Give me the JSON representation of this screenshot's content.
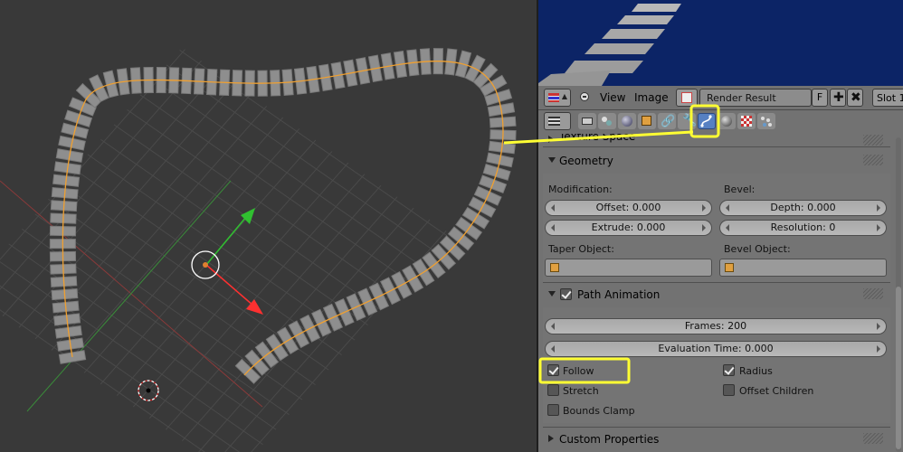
{
  "image_editor": {
    "menu_view": "View",
    "menu_image": "Image",
    "image_name": "Render Result",
    "fake_user": "F",
    "slot": "Slot 1"
  },
  "properties": {
    "texture_space": {
      "title": "Texture Space"
    },
    "geometry": {
      "title": "Geometry",
      "modification_label": "Modification:",
      "bevel_label": "Bevel:",
      "offset": "Offset: 0.000",
      "extrude": "Extrude: 0.000",
      "depth": "Depth: 0.000",
      "resolution": "Resolution: 0",
      "taper_label": "Taper Object:",
      "bevel_object_label": "Bevel Object:"
    },
    "path_animation": {
      "title": "Path Animation",
      "enabled": true,
      "frames": "Frames: 200",
      "evaluation_time": "Evaluation Time: 0.000",
      "follow": {
        "label": "Follow",
        "checked": true
      },
      "radius": {
        "label": "Radius",
        "checked": true
      },
      "stretch": {
        "label": "Stretch",
        "checked": false
      },
      "offset_children": {
        "label": "Offset Children",
        "checked": false
      },
      "bounds_clamp": {
        "label": "Bounds Clamp",
        "checked": false
      }
    },
    "custom_properties": {
      "title": "Custom Properties"
    }
  },
  "colors": {
    "highlight": "#ffff33",
    "curve": "#f0a030",
    "axis_x": "#ff3030",
    "axis_y": "#30c030",
    "render_bg": "#0c2466",
    "active_tab": "#5680c2"
  },
  "icons": [
    "menu-icon",
    "collapse-icon",
    "image-icon",
    "add-icon",
    "close-icon",
    "render-tab-icon",
    "scene-tab-icon",
    "world-tab-icon",
    "object-tab-icon",
    "constraints-tab-icon",
    "modifiers-tab-icon",
    "curve-data-tab-icon",
    "material-tab-icon",
    "texture-tab-icon",
    "particles-tab-icon",
    "cube-icon",
    "cursor-icon"
  ]
}
